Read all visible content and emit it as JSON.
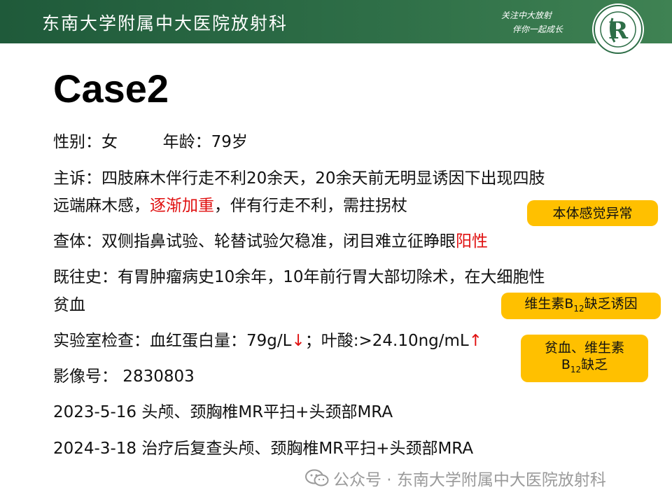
{
  "header": {
    "title": "东南大学附属中大医院放射科",
    "slogan_line1": "关注中大放射",
    "slogan_line2": "伴你一起成长"
  },
  "slide": {
    "title": "Case2",
    "sex_label": "性别：女",
    "age_label": "年龄：79岁",
    "complaint_line1": "主诉：四肢麻木伴行走不利20余天，20余天前无明显诱因下出现四肢",
    "complaint_line2_a": "远端麻木感，",
    "complaint_line2_red": "逐渐加重",
    "complaint_line2_b": "，伴有行走不利，需拄拐杖",
    "exam_a": "查体：双侧指鼻试验、轮替试验欠稳准，闭目难立征睁眼",
    "exam_red": "阳性",
    "history_line1": "既往史：有胃肿瘤病史10余年，10年前行胃大部切除术，在大细胞性",
    "history_line2": "贫血",
    "lab_a": "实验室检查：血红蛋白量：79g/L",
    "lab_arrow_down": "↓",
    "lab_b": "；叶酸:>24.10ng/mL",
    "lab_arrow_up": "↑",
    "image_no": "影像号： 2830803",
    "exam_2023": "2023-5-16  头颅、颈胸椎MR平扫+头颈部MRA",
    "exam_2024": "2024-3-18  治疗后复查头颅、颈胸椎MR平扫+头颈部MRA"
  },
  "tags": {
    "tag1": "本体感觉异常",
    "tag2_pre": "维生素B",
    "tag2_sub": "12",
    "tag2_post": "缺乏诱因",
    "tag3_line1": "贫血、维生素",
    "tag3_pre": "B",
    "tag3_sub": "12",
    "tag3_post": "缺乏"
  },
  "watermark": {
    "text": "公众号 · 东南大学附属中大医院放射科"
  },
  "colors": {
    "header_green": "#2e6e47",
    "tag_yellow": "#ffc000",
    "highlight_red": "#e01010"
  }
}
